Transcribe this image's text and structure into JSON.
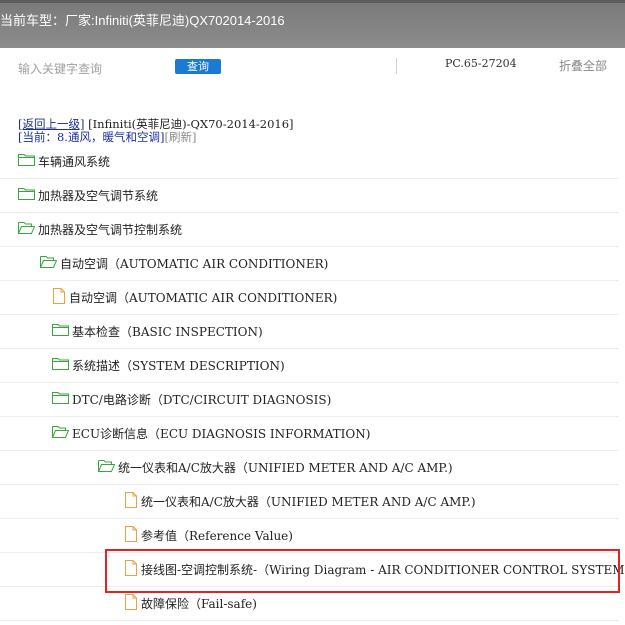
{
  "header": {
    "label": "当前车型：",
    "vehicle": "厂家:Infiniti(英菲尼迪)QX702014-2016"
  },
  "search": {
    "placeholder": "输入关键字查询",
    "button_label": "查询"
  },
  "pc_code": "PC.65-27204",
  "collapse_all_label": "折叠全部",
  "breadcrumb": {
    "back_label": "[返回上一级]",
    "path": "[Infiniti(英菲尼迪)-QX70-2014-2016]",
    "current": "[当前：8.通风，暖气和空调]",
    "refresh": "[刷新]"
  },
  "tree": [
    {
      "type": "folder",
      "label": "车辆通风系统"
    },
    {
      "type": "folder",
      "label": "加热器及空气调节系统"
    },
    {
      "type": "folder-open",
      "label": "加热器及空气调节控制系统"
    },
    {
      "type": "folder-open",
      "label": "自动空调（AUTOMATIC AIR CONDITIONER)"
    },
    {
      "type": "file",
      "label": "自动空调（AUTOMATIC AIR CONDITIONER)"
    },
    {
      "type": "folder",
      "label": "基本检查（BASIC INSPECTION)"
    },
    {
      "type": "folder",
      "label": "系统描述（SYSTEM DESCRIPTION)"
    },
    {
      "type": "folder",
      "label": "DTC/电路诊断（DTC/CIRCUIT DIAGNOSIS)"
    },
    {
      "type": "folder-open",
      "label": "ECU诊断信息（ECU DIAGNOSIS INFORMATION)"
    },
    {
      "type": "folder-open",
      "label": "统一仪表和A/C放大器（UNIFIED METER AND A/C AMP.)"
    },
    {
      "type": "file",
      "label": "统一仪表和A/C放大器（UNIFIED METER AND A/C AMP.)"
    },
    {
      "type": "file",
      "label": "参考值（Reference Value)"
    },
    {
      "type": "file",
      "label": "接线图-空调控制系统-（Wiring Diagram - AIR CONDITIONER CONTROL SYSTEM -)",
      "highlighted": true
    },
    {
      "type": "file",
      "label": "故障保险（Fail-safe)"
    }
  ],
  "colors": {
    "folder": "#3aa53a",
    "file": "#e8a040",
    "highlight": "#e02424",
    "search_button": "#1a7ad4",
    "link": "#1a2f9c"
  }
}
